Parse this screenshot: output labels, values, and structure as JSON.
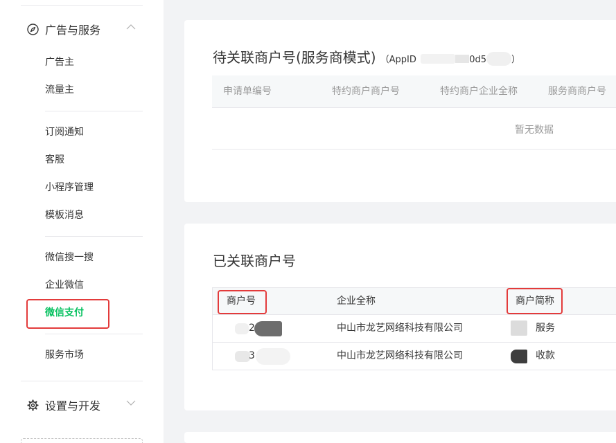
{
  "sidebar": {
    "groups": [
      {
        "label": "广告与服务",
        "icon": "compass-icon",
        "expanded": true
      },
      {
        "label": "设置与开发",
        "icon": "gear-icon",
        "expanded": false
      }
    ],
    "section1": [
      "广告主",
      "流量主"
    ],
    "section2": [
      "订阅通知",
      "客服",
      "小程序管理",
      "模板消息"
    ],
    "section3": [
      "微信搜一搜",
      "企业微信",
      "微信支付"
    ],
    "section4": [
      "服务市场"
    ],
    "active_item": "微信支付"
  },
  "pending_card": {
    "title": "待关联商户号(服务商模式)",
    "appid_prefix": "（AppID",
    "appid_visible": "0d5",
    "appid_suffix": "）",
    "columns": [
      "申请单编号",
      "特约商户商户号",
      "特约商户企业全称",
      "服务商商户号"
    ],
    "empty_text": "暂无数据"
  },
  "linked_card": {
    "title": "已关联商户号",
    "columns": [
      "商户号",
      "企业全称",
      "商户简称"
    ],
    "rows": [
      {
        "merchant_id_visible": "2",
        "company": "中山市龙艺网络科技有限公司",
        "short_name_visible": "服务"
      },
      {
        "merchant_id_visible": "3",
        "company": "中山市龙艺网络科技有限公司",
        "short_name_visible": "收款"
      }
    ]
  },
  "colors": {
    "accent_green": "#07c160",
    "highlight_red": "#e33b3b",
    "page_bg": "#f2f3f5",
    "muted_text": "#9a9a9a"
  }
}
